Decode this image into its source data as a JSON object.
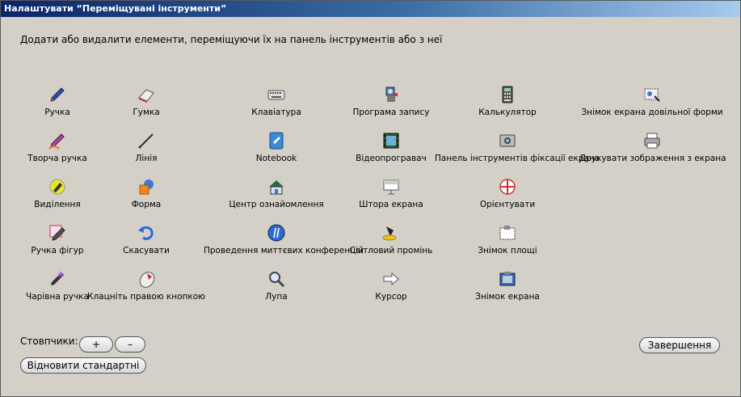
{
  "window": {
    "title": "Налаштувати “Переміщувані інструменти”"
  },
  "instruction": "Додати або видалити елементи, переміщуючи їх на панель інструментів або з неї",
  "tools": [
    {
      "label": "Ручка",
      "icon": "pen-icon"
    },
    {
      "label": "Гумка",
      "icon": "eraser-icon"
    },
    {
      "label": "Клавіатура",
      "icon": "keyboard-icon"
    },
    {
      "label": "Програма запису",
      "icon": "recorder-icon"
    },
    {
      "label": "Калькулятор",
      "icon": "calculator-icon"
    },
    {
      "label": "Знімок екрана довільної форми",
      "icon": "freeform-capture-icon"
    },
    {
      "label": "Творча ручка",
      "icon": "creative-pen-icon"
    },
    {
      "label": "Лінія",
      "icon": "line-icon"
    },
    {
      "label": "Notebook",
      "icon": "notebook-icon"
    },
    {
      "label": "Відеопрогравач",
      "icon": "video-player-icon"
    },
    {
      "label": "Панель інструментів фіксації екрана",
      "icon": "screen-capture-toolbar-icon"
    },
    {
      "label": "Друкувати зображення з екрана",
      "icon": "print-screen-icon"
    },
    {
      "label": "Виділення",
      "icon": "highlighter-icon"
    },
    {
      "label": "Форма",
      "icon": "shape-icon"
    },
    {
      "label": "Центр ознайомлення",
      "icon": "welcome-center-icon"
    },
    {
      "label": "Штора екрана",
      "icon": "screen-shade-icon"
    },
    {
      "label": "Орієнтувати",
      "icon": "orient-icon"
    },
    {
      "label": "Ручка фігур",
      "icon": "shape-pen-icon"
    },
    {
      "label": "Скасувати",
      "icon": "undo-icon"
    },
    {
      "label": "Проведення миттєвих конференцій",
      "icon": "instant-conference-icon"
    },
    {
      "label": "Світловий промінь",
      "icon": "spotlight-icon"
    },
    {
      "label": "Знімок площі",
      "icon": "area-capture-icon"
    },
    {
      "label": "Чарівна ручка",
      "icon": "magic-pen-icon"
    },
    {
      "label": "Клацніть правою кнопкою",
      "icon": "right-click-icon"
    },
    {
      "label": "Лупа",
      "icon": "magnifier-icon"
    },
    {
      "label": "Курсор",
      "icon": "cursor-icon"
    },
    {
      "label": "Знімок екрана",
      "icon": "screen-capture-icon"
    }
  ],
  "columns": {
    "label": "Стовпчики:",
    "plus": "+",
    "minus": "–"
  },
  "restore_button": "Відновити стандартні",
  "done_button": "Завершення"
}
